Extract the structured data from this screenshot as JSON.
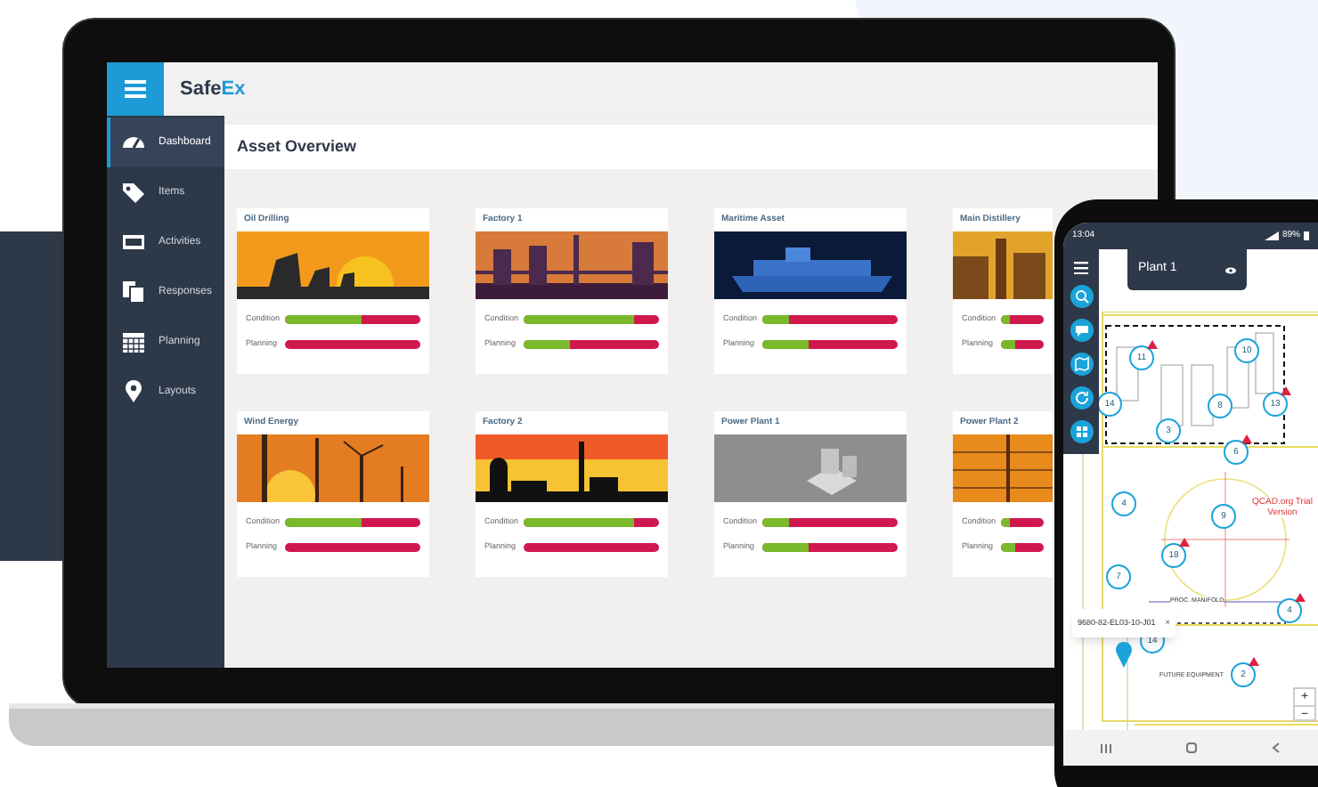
{
  "laptop": {
    "app": {
      "logo": [
        "Safe",
        "Ex"
      ],
      "sidebar": [
        {
          "label": "Dashboard",
          "selected": true
        },
        {
          "label": "Items",
          "selected": false
        },
        {
          "label": "Activities",
          "selected": false
        },
        {
          "label": "Responses",
          "selected": false
        },
        {
          "label": "Planning",
          "selected": false
        },
        {
          "label": "Layouts",
          "selected": false
        }
      ],
      "page_title": "Asset Overview",
      "assets": [
        {
          "name": "Oil Drilling",
          "condition": {
            "label": "Condition",
            "level": 0.56
          },
          "planning": {
            "label": "Planning",
            "level": 0
          }
        },
        {
          "name": "Factory 1",
          "condition": {
            "label": "Condition",
            "level": 0.81
          },
          "planning": {
            "label": "Planning",
            "level": 0.34
          }
        },
        {
          "name": "Maritime Asset",
          "condition": {
            "label": "Condition",
            "level": 0.2
          },
          "planning": {
            "label": "Planning",
            "level": 0.34
          }
        },
        {
          "name": "Main Distillery",
          "condition": {
            "label": "Condition",
            "level": 0.2
          },
          "planning": {
            "label": "Planning",
            "level": 0.34
          }
        },
        {
          "name": "Wind Energy",
          "condition": {
            "label": "Condition",
            "level": 0.56
          },
          "planning": {
            "label": "Planning",
            "level": 0
          }
        },
        {
          "name": "Factory 2",
          "condition": {
            "label": "Condition",
            "level": 0.82
          },
          "planning": {
            "label": "Planning",
            "level": 0
          }
        },
        {
          "name": "Power Plant 1",
          "condition": {
            "label": "Condition",
            "level": 0.2
          },
          "planning": {
            "label": "Planning",
            "level": 0.34
          }
        },
        {
          "name": "Power Plant 2",
          "condition": {
            "label": "Condition",
            "level": 0.2
          },
          "planning": {
            "label": "Planning",
            "level": 0.34
          }
        }
      ]
    }
  },
  "phone": {
    "status_bar": {
      "time": "13:04",
      "battery": "89%"
    },
    "layout_title": "Plant 1",
    "plan": {
      "labels": [
        {
          "kind": "watermark",
          "text": "QCAD.org Trial Version"
        },
        {
          "kind": "note",
          "text": "PROC. MANIFOLD"
        },
        {
          "kind": "note",
          "text": "FUTURE EQUIPMENT"
        }
      ],
      "pins": [
        {
          "number": "11",
          "alert": true
        },
        {
          "number": "10",
          "alert": false
        },
        {
          "number": "14",
          "alert": false
        },
        {
          "number": "8",
          "alert": false
        },
        {
          "number": "13",
          "alert": true
        },
        {
          "number": "3",
          "alert": false
        },
        {
          "number": "6",
          "alert": true
        },
        {
          "number": "4",
          "alert": false
        },
        {
          "number": "9",
          "alert": false
        },
        {
          "number": "18",
          "alert": true
        },
        {
          "number": "7",
          "alert": false
        },
        {
          "number": "4",
          "alert": true
        },
        {
          "number": "14",
          "alert": false
        },
        {
          "number": "2",
          "alert": true
        }
      ],
      "popup": {
        "text": "9680-82-EL03-10-J01",
        "close": "×"
      }
    },
    "zoom": {
      "in": "+",
      "out": "−"
    }
  }
}
